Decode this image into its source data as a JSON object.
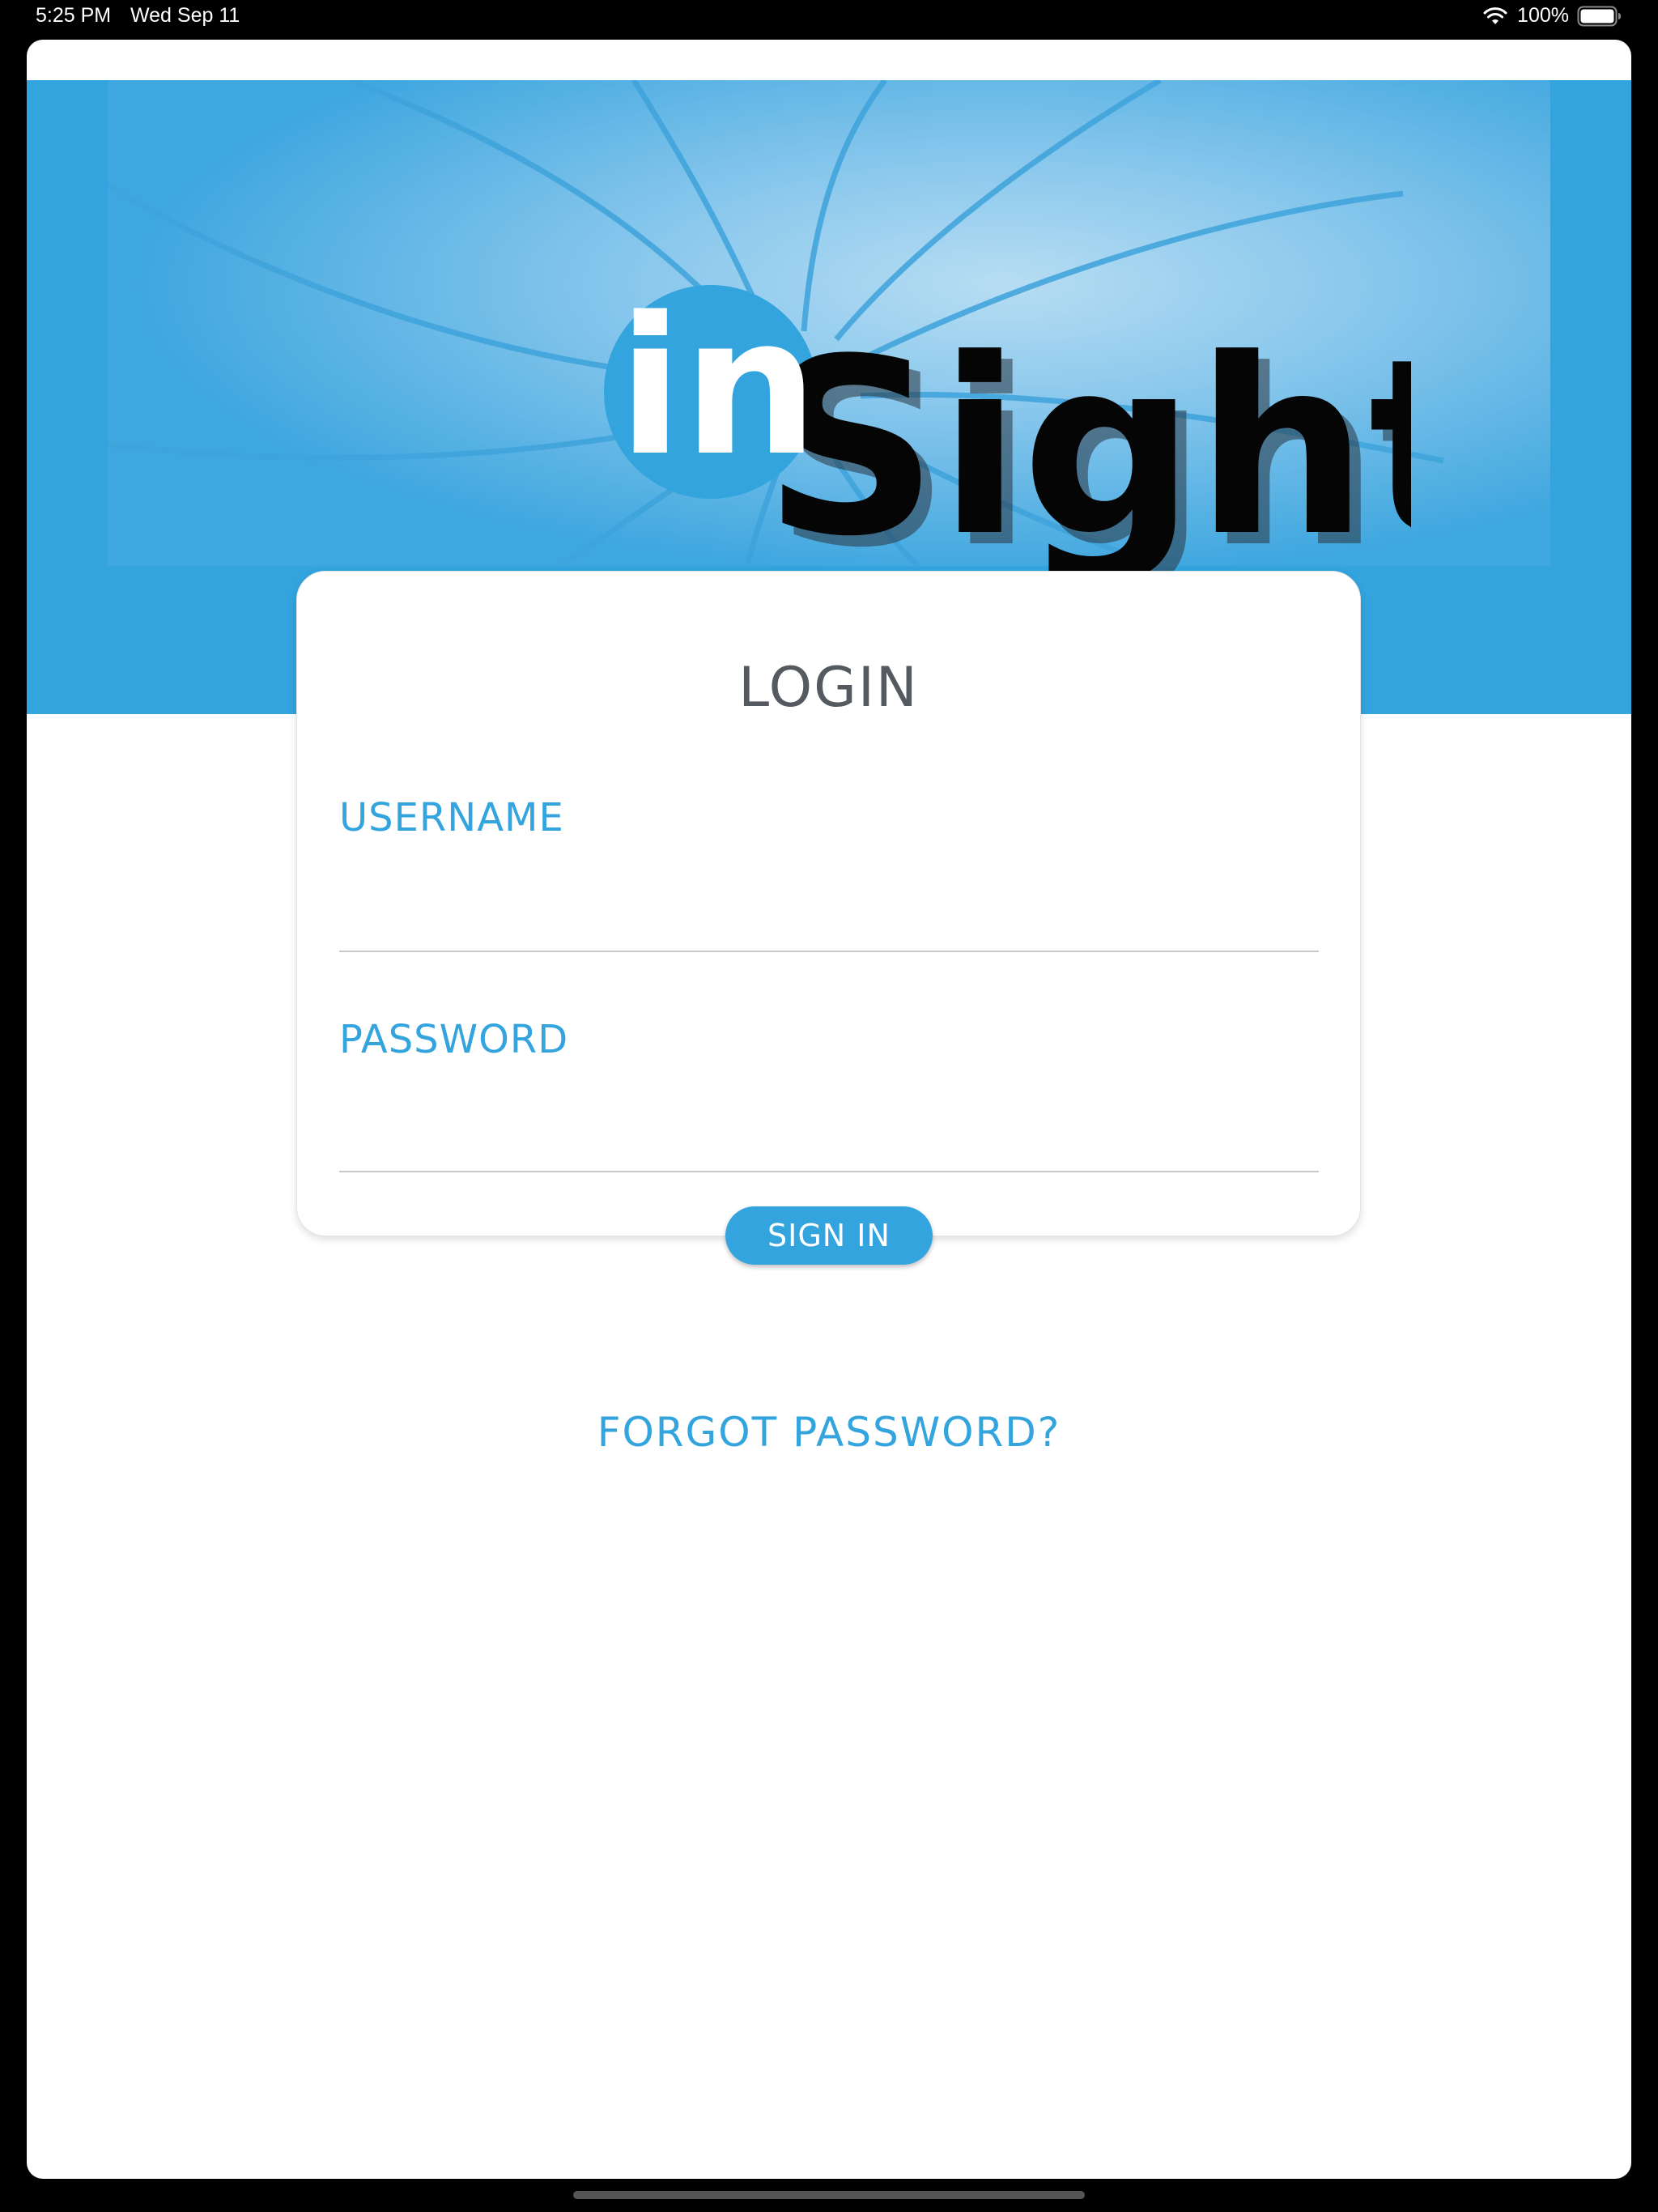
{
  "status_bar": {
    "time": "5:25 PM",
    "date": "Wed Sep 11",
    "battery_percent": "100%",
    "wifi_icon": "wifi-icon",
    "battery_icon": "battery-icon",
    "battery_level": 1.0
  },
  "header": {
    "logo_text_in": "in",
    "logo_text_sight": "Sight",
    "brand_color": "#33a4de"
  },
  "login": {
    "title": "LOGIN",
    "username_label": "USERNAME",
    "username_value": "",
    "password_label": "PASSWORD",
    "password_value": "",
    "signin_label": "SIGN IN",
    "forgot_label": "FORGOT PASSWORD?"
  },
  "colors": {
    "accent": "#33a4de",
    "title_text": "#555a60",
    "background": "#ffffff"
  }
}
